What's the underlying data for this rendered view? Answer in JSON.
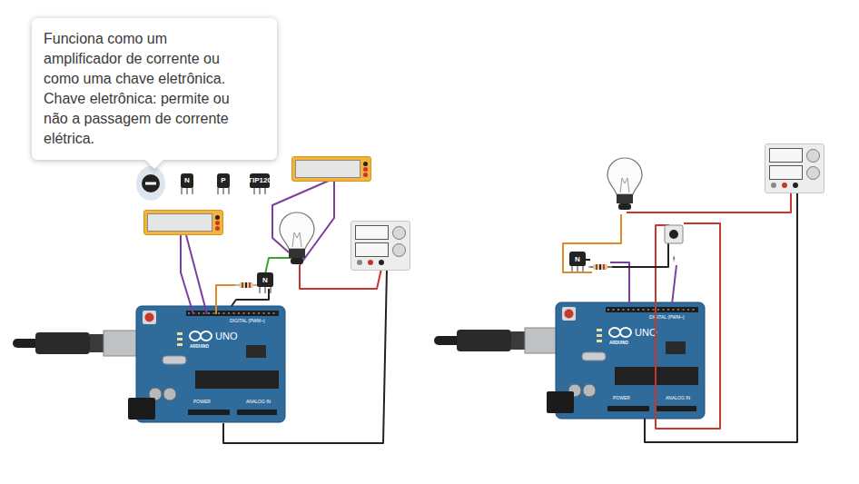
{
  "tooltip": {
    "lines": [
      "Funciona como um",
      "amplificador de corrente ou",
      "como uma chave eletrônica.",
      "Chave eletrônica: permite ou",
      "não a passagem de corrente",
      "elétrica."
    ]
  },
  "palette": [
    {
      "kind": "circle",
      "label": "",
      "selected": true
    },
    {
      "kind": "npn",
      "label": "N",
      "selected": false
    },
    {
      "kind": "pnp",
      "label": "P",
      "selected": false
    },
    {
      "kind": "darlington",
      "label": "TIP120",
      "selected": false
    }
  ],
  "circuits": [
    {
      "board": {
        "brand": "ARDUINO",
        "model": "UNO",
        "digital": "DIGITAL (PWM~)",
        "power": "POWER",
        "analog": "ANALOG IN"
      },
      "transistor": {
        "label": "N"
      },
      "multimeters": 2,
      "button": false
    },
    {
      "board": {
        "brand": "ARDUINO",
        "model": "UNO",
        "digital": "DIGITAL (PWM~)",
        "power": "POWER",
        "analog": "ANALOG IN"
      },
      "transistor": {
        "label": "N"
      },
      "multimeters": 0,
      "button": true
    }
  ]
}
